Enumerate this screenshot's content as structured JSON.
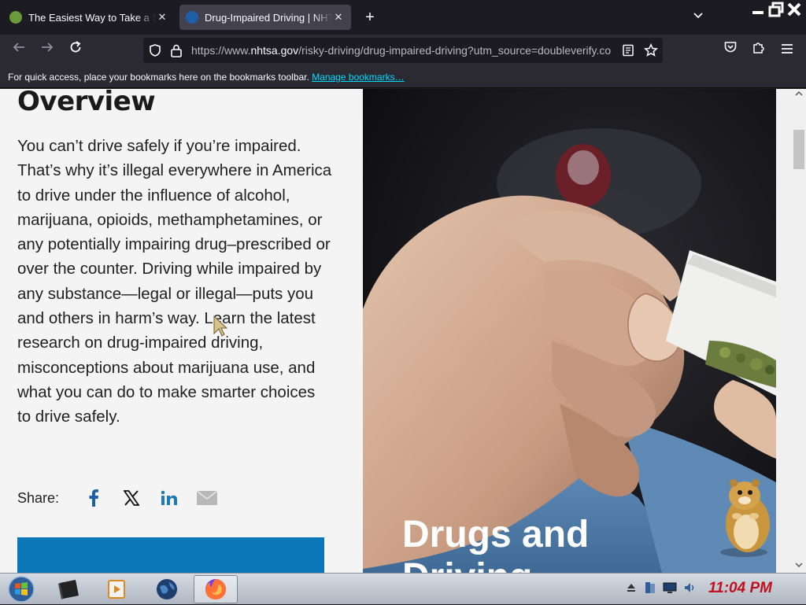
{
  "browser": {
    "tabs": [
      {
        "title": "The Easiest Way to Take a Scr",
        "active": false,
        "favicon_color": "#6b9a3a"
      },
      {
        "title": "Drug-Impaired Driving | NHTSA",
        "active": true,
        "favicon_color": "#1f5fa8"
      }
    ],
    "url_prefix": "https://www.",
    "url_domain": "nhtsa.gov",
    "url_rest": "/risky-driving/drug-impaired-driving?utm_source=doubleverify.co",
    "bookmarks_text": "For quick access, place your bookmarks here on the bookmarks toolbar.",
    "bookmarks_link": "Manage bookmarks…"
  },
  "page": {
    "heading": "Overview",
    "paragraph": "You can’t drive safely if you’re impaired. That’s why it’s illegal everywhere in America to drive under the influence of alcohol, marijuana, opioids, methamphetamines, or any potentially impairing drug–prescribed or over the counter. Driving while impaired by any substance—legal or illegal—puts you and others in harm’s way. Learn the latest research on drug-impaired driving, misconceptions about marijuana use, and what you can do to make smarter choices to drive safely.",
    "share_label": "Share:",
    "photo_title_line1": "Drugs and",
    "photo_title_line2": "Driving",
    "accent_color": "#0b76b8"
  },
  "taskbar": {
    "clock": "11:04 PM"
  }
}
